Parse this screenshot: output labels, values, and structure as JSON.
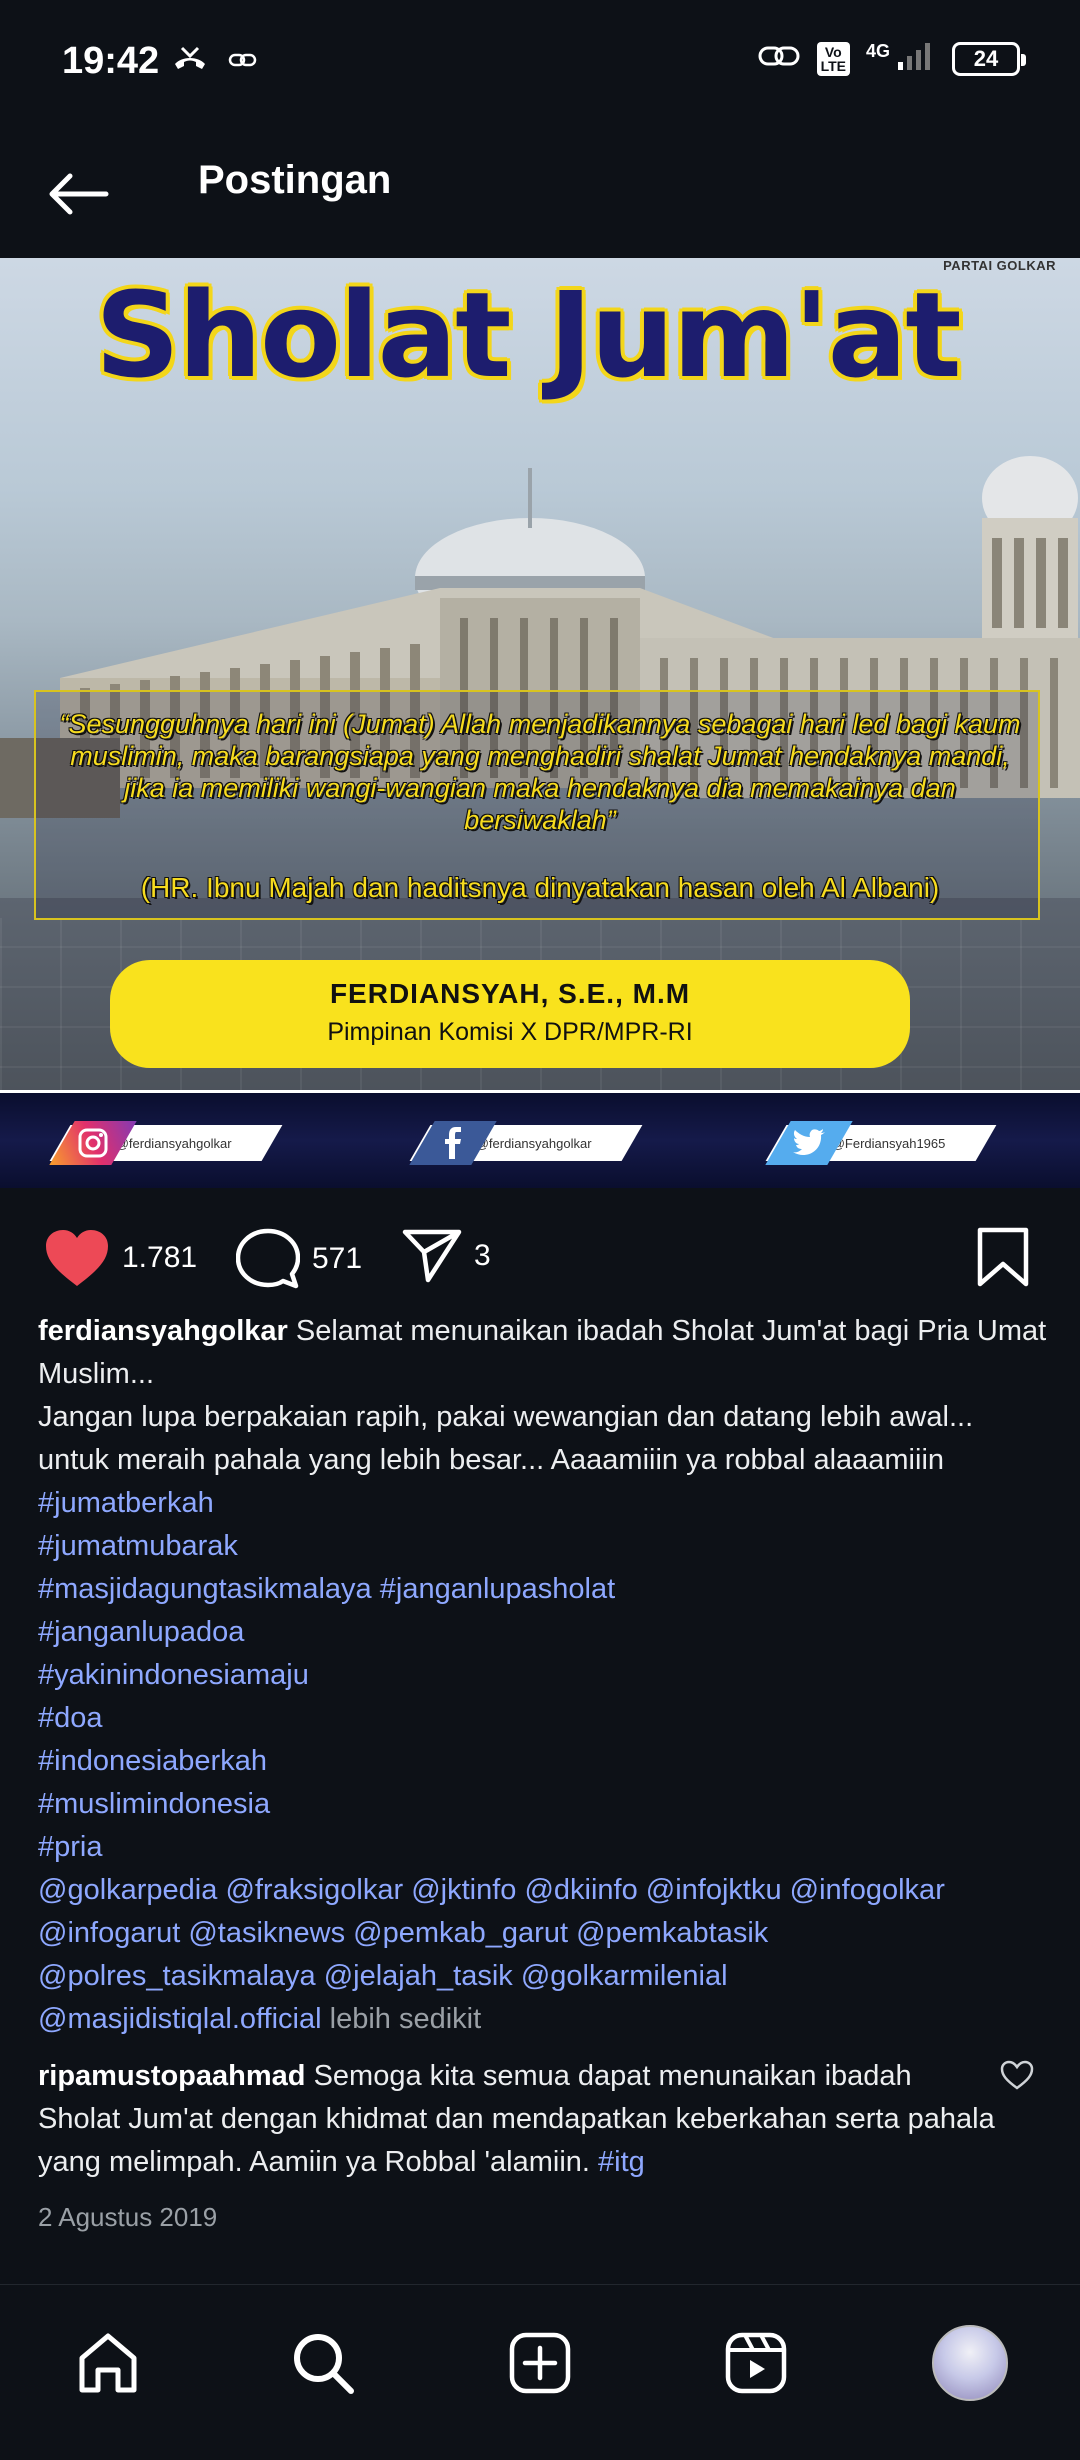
{
  "status_bar": {
    "time": "19:42",
    "lte": "Vo\nLTE",
    "network": "4G",
    "battery": "24",
    "icons": [
      "missed-call-icon",
      "link-icon",
      "hotspot-icon",
      "signal-icon",
      "battery-icon"
    ]
  },
  "header": {
    "title": "Postingan",
    "back_icon": "arrow-left-icon"
  },
  "post_image": {
    "brand": "PARTAI GOLKAR",
    "title": "Sholat  Jum'at",
    "quote": "“Sesungguhnya hari ini (Jumat) Allah menjadikannya sebagai hari led bagi kaum muslimin, maka barangsiapa yang menghadiri shalat Jumat hendaknya mandi, jika ia memiliki wangi-wangian maka hendaknya dia memakainya dan bersiwaklah”",
    "source": "(HR. Ibnu Majah dan haditsnya dinyatakan hasan oleh Al Albani)",
    "name": "FERDIANSYAH, S.E., M.M",
    "role": "Pimpinan Komisi X DPR/MPR-RI",
    "socials": [
      {
        "platform": "instagram",
        "handle": "@ferdiansyahgolkar"
      },
      {
        "platform": "facebook",
        "handle": "@ferdiansyahgolkar"
      },
      {
        "platform": "twitter",
        "handle": "@Ferdiansyah1965"
      }
    ]
  },
  "actions": {
    "likes": "1.781",
    "comments": "571",
    "shares": "3",
    "like_color": "#ed4956"
  },
  "caption": {
    "username": "ferdiansyahgolkar",
    "text_line1": "Selamat menunaikan ibadah Sholat Jum'at bagi Pria Umat Muslim...",
    "text_line2": "Jangan lupa berpakaian rapih, pakai wewangian dan datang lebih awal... untuk meraih pahala yang lebih besar... Aaaamiiin ya robbal alaaamiiin",
    "hashtags": [
      "#jumatberkah",
      "#jumatmubarak"
    ],
    "hashtag_pair": [
      "#masjidagungtasikmalaya",
      "#janganlupasholat"
    ],
    "hashtags_more": [
      "#janganlupadoa",
      "#yakinindonesiamaju",
      "#doa",
      "#indonesiaberkah",
      "#muslimindonesia",
      "#pria"
    ],
    "mentions_line1": "@golkarpedia @fraksigolkar @jktinfo @dkiinfo @infojktku @infogolkar",
    "mentions_line2": "@infogarut @tasiknews @pemkab_garut @pemkabtasik",
    "mentions_line3": "@polres_tasikmalaya @jelajah_tasik @golkarmilenial",
    "mentions_line4": "@masjidistiqlal.official",
    "more_label": "lebih sedikit",
    "link_color": "#8ea8ff"
  },
  "comment": {
    "username": "ripamustopaahmad",
    "text": "Semoga kita semua dapat menunaikan ibadah Sholat Jum'at dengan khidmat dan mendapatkan keberkahan serta pahala yang melimpah. Aamiin ya Robbal 'alamiin.",
    "tag": "#itg"
  },
  "post_date": "2 Agustus 2019",
  "bottom_nav": [
    "home-icon",
    "search-icon",
    "add-post-icon",
    "reels-icon",
    "profile-avatar"
  ]
}
